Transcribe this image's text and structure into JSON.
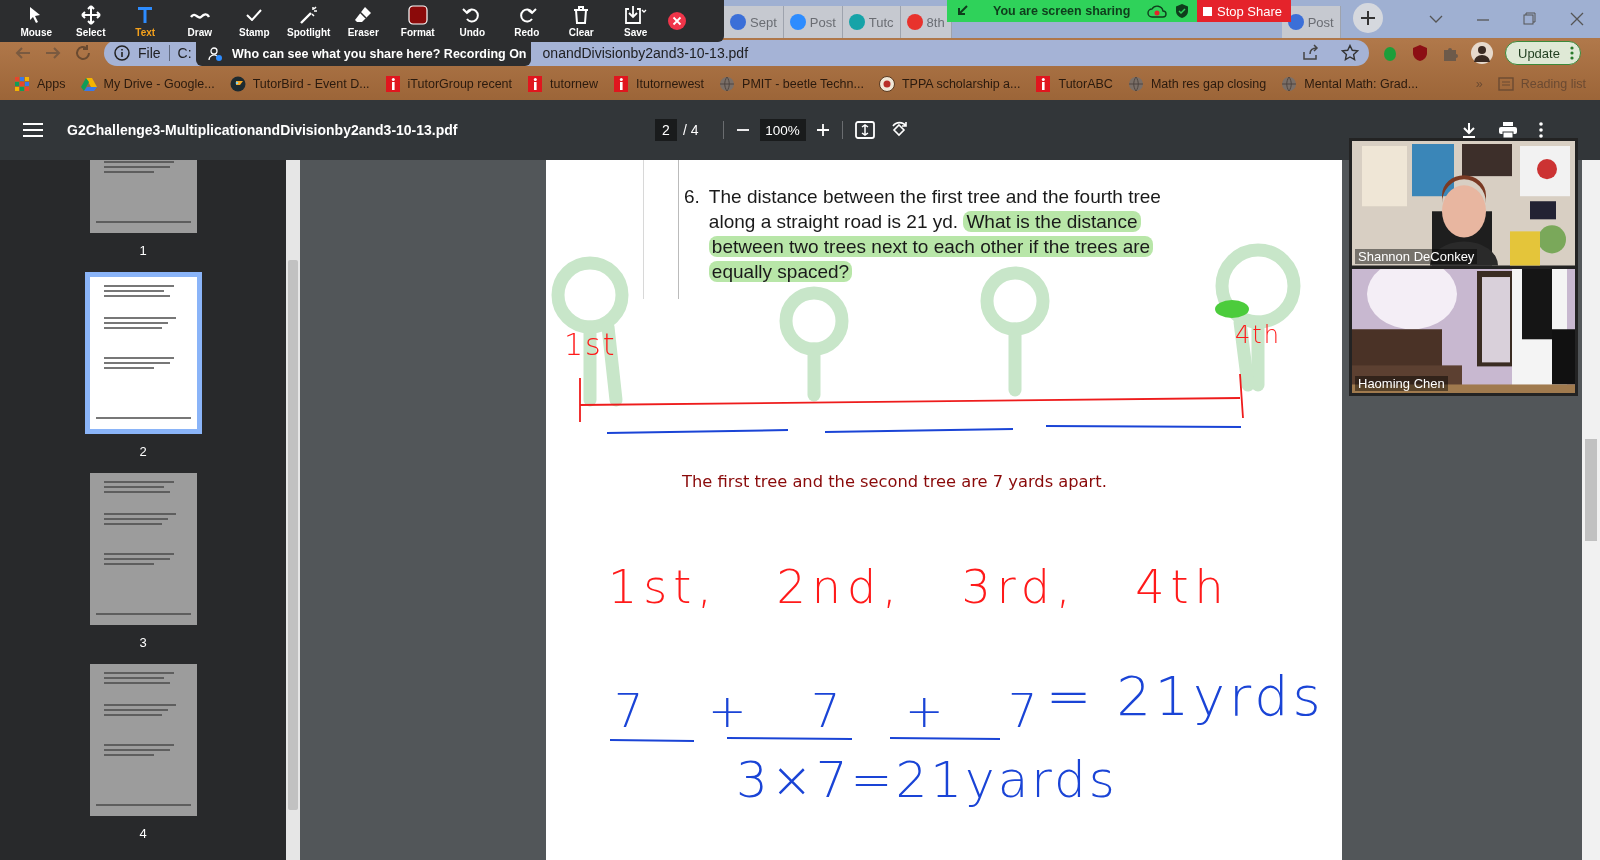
{
  "zoom_toolbar": {
    "tools": [
      {
        "kind": "mouse",
        "label": "Mouse",
        "selected": false
      },
      {
        "kind": "select",
        "label": "Select",
        "selected": false
      },
      {
        "kind": "text",
        "label": "Text",
        "selected": true
      },
      {
        "kind": "draw",
        "label": "Draw",
        "selected": false
      },
      {
        "kind": "stamp",
        "label": "Stamp",
        "selected": false
      },
      {
        "kind": "spotlight",
        "label": "Spotlight",
        "selected": false
      },
      {
        "kind": "eraser",
        "label": "Eraser",
        "selected": false
      },
      {
        "kind": "format",
        "label": "Format",
        "selected": false
      },
      {
        "kind": "undo",
        "label": "Undo",
        "selected": false
      },
      {
        "kind": "redo",
        "label": "Redo",
        "selected": false
      },
      {
        "kind": "clear",
        "label": "Clear",
        "selected": false
      },
      {
        "kind": "save",
        "label": "Save",
        "selected": false
      }
    ]
  },
  "share_tooltip": "Who can see what you share here? Recording On",
  "browser_tabs": [
    {
      "label": "Sept",
      "color": "#3b6fd8"
    },
    {
      "label": "Post",
      "color": "#2d8cff"
    },
    {
      "label": "Tutc",
      "color": "#16a3a8"
    },
    {
      "label": "8th",
      "color": "#e8322c"
    },
    {
      "label": "Post",
      "color": "#3b6fd8"
    }
  ],
  "share_banner": {
    "status": "You are screen sharing",
    "stop_label": "Stop Share"
  },
  "address_bar": {
    "scheme": "File",
    "path_start": "C:",
    "path_end": "onandDivisionby2and3-10-13.pdf"
  },
  "update_button": "Update",
  "bookmarks": [
    {
      "kind": "apps",
      "label": "Apps"
    },
    {
      "kind": "drive",
      "label": "My Drive - Google..."
    },
    {
      "kind": "bird",
      "label": "TutorBird - Event D..."
    },
    {
      "kind": "itutor",
      "label": "iTutorGroup recent"
    },
    {
      "kind": "itutor",
      "label": "tutornew"
    },
    {
      "kind": "itutor",
      "label": "Itutornewest"
    },
    {
      "kind": "globe",
      "label": "PMIT - beetle Techn..."
    },
    {
      "kind": "seal",
      "label": "TPPA scholarship a..."
    },
    {
      "kind": "itutor",
      "label": "TutorABC"
    },
    {
      "kind": "globe",
      "label": "Math res gap closing"
    },
    {
      "kind": "globe",
      "label": "Mental Math: Grad..."
    }
  ],
  "bookmarks_overflow": "»",
  "reading_list": "Reading list",
  "pdf_toolbar": {
    "title": "G2Challenge3-MultiplicationandDivisionby2and3-10-13.pdf",
    "page": "2",
    "page_count": "/ 4",
    "zoom": "100%"
  },
  "thumbnails": [
    {
      "label": "1",
      "selected": false
    },
    {
      "label": "2",
      "selected": true
    },
    {
      "label": "3",
      "selected": false
    },
    {
      "label": "4",
      "selected": false
    }
  ],
  "document": {
    "question": {
      "number": "6.",
      "text": "The distance between the first tree and the fourth tree along a straight road is 21 yd.",
      "highlighted": "What is the distance between two trees next to each other if the trees are equally spaced?"
    },
    "answer": "The first tree and the second tree are 7 yards apart.",
    "handwriting": [
      {
        "text": "1st",
        "color": "#ff1a1a"
      },
      {
        "text": "4th",
        "color": "#ff1a1a"
      },
      {
        "text": "1st, 2nd, 3rd, 4th",
        "color": "#ff1a1a"
      },
      {
        "text": "7 + 7 + 7",
        "color": "#1a44d6"
      },
      {
        "text": "= 21yrds",
        "color": "#1a44d6"
      },
      {
        "text": "3×7=21yards",
        "color": "#1a44d6"
      }
    ]
  },
  "participants": [
    {
      "name": "Shannon DeConkey"
    },
    {
      "name": "Haoming Chen"
    }
  ]
}
